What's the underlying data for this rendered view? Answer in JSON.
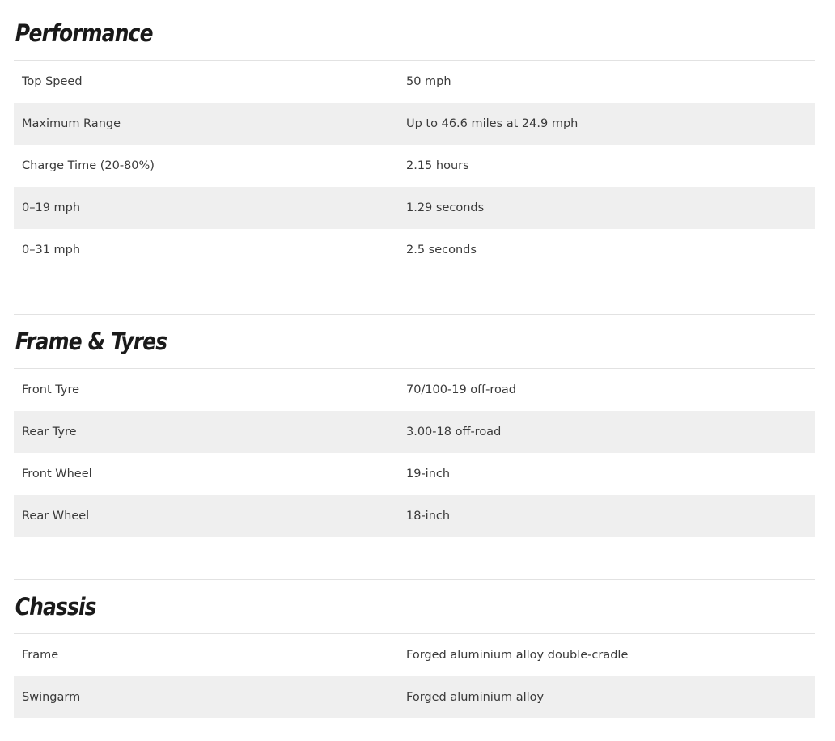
{
  "sections": [
    {
      "title": "Performance",
      "rows": [
        {
          "label": "Top Speed",
          "value": "50 mph"
        },
        {
          "label": "Maximum Range",
          "value": "Up to 46.6 miles at 24.9 mph"
        },
        {
          "label": "Charge Time (20-80%)",
          "value": "2.15 hours"
        },
        {
          "label": "0–19 mph",
          "value": "1.29 seconds"
        },
        {
          "label": "0–31 mph",
          "value": "2.5 seconds"
        }
      ]
    },
    {
      "title": "Frame & Tyres",
      "rows": [
        {
          "label": "Front Tyre",
          "value": "70/100-19 off-road"
        },
        {
          "label": "Rear Tyre",
          "value": "3.00-18 off-road"
        },
        {
          "label": "Front Wheel",
          "value": "19-inch"
        },
        {
          "label": "Rear Wheel",
          "value": "18-inch"
        }
      ]
    },
    {
      "title": "Chassis",
      "rows": [
        {
          "label": "Frame",
          "value": "Forged aluminium alloy double-cradle"
        },
        {
          "label": "Swingarm",
          "value": "Forged aluminium alloy"
        }
      ]
    }
  ]
}
